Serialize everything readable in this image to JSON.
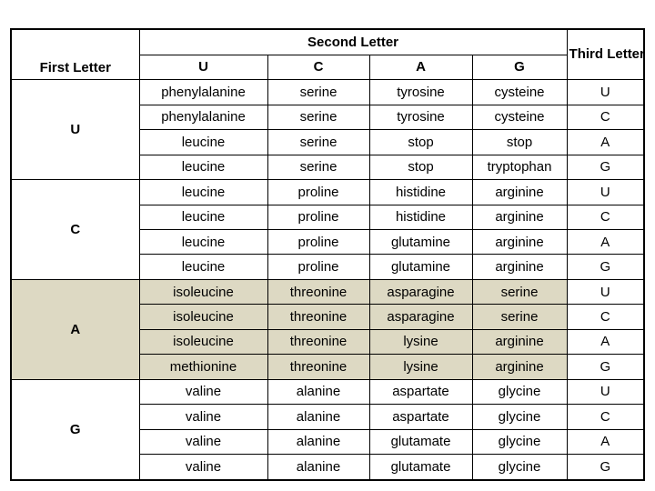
{
  "table": {
    "headers": {
      "first_letter": "First Letter",
      "second_letter": "Second Letter",
      "third_letter": "Third Letter",
      "second_letter_columns": [
        "U",
        "C",
        "A",
        "G"
      ]
    },
    "highlight_color": "#DDD9C3",
    "highlighted_block": "A",
    "blocks": [
      {
        "first_letter": "U",
        "shaded": false,
        "rows": [
          {
            "third_letter": "U",
            "cells": [
              "phenylalanine",
              "serine",
              "tyrosine",
              "cysteine"
            ]
          },
          {
            "third_letter": "C",
            "cells": [
              "phenylalanine",
              "serine",
              "tyrosine",
              "cysteine"
            ]
          },
          {
            "third_letter": "A",
            "cells": [
              "leucine",
              "serine",
              "stop",
              "stop"
            ]
          },
          {
            "third_letter": "G",
            "cells": [
              "leucine",
              "serine",
              "stop",
              "tryptophan"
            ]
          }
        ]
      },
      {
        "first_letter": "C",
        "shaded": false,
        "rows": [
          {
            "third_letter": "U",
            "cells": [
              "leucine",
              "proline",
              "histidine",
              "arginine"
            ]
          },
          {
            "third_letter": "C",
            "cells": [
              "leucine",
              "proline",
              "histidine",
              "arginine"
            ]
          },
          {
            "third_letter": "A",
            "cells": [
              "leucine",
              "proline",
              "glutamine",
              "arginine"
            ]
          },
          {
            "third_letter": "G",
            "cells": [
              "leucine",
              "proline",
              "glutamine",
              "arginine"
            ]
          }
        ]
      },
      {
        "first_letter": "A",
        "shaded": true,
        "rows": [
          {
            "third_letter": "U",
            "cells": [
              "isoleucine",
              "threonine",
              "asparagine",
              "serine"
            ]
          },
          {
            "third_letter": "C",
            "cells": [
              "isoleucine",
              "threonine",
              "asparagine",
              "serine"
            ]
          },
          {
            "third_letter": "A",
            "cells": [
              "isoleucine",
              "threonine",
              "lysine",
              "arginine"
            ]
          },
          {
            "third_letter": "G",
            "cells": [
              "methionine",
              "threonine",
              "lysine",
              "arginine"
            ]
          }
        ]
      },
      {
        "first_letter": "G",
        "shaded": false,
        "rows": [
          {
            "third_letter": "U",
            "cells": [
              "valine",
              "alanine",
              "aspartate",
              "glycine"
            ]
          },
          {
            "third_letter": "C",
            "cells": [
              "valine",
              "alanine",
              "aspartate",
              "glycine"
            ]
          },
          {
            "third_letter": "A",
            "cells": [
              "valine",
              "alanine",
              "glutamate",
              "glycine"
            ]
          },
          {
            "third_letter": "G",
            "cells": [
              "valine",
              "alanine",
              "glutamate",
              "glycine"
            ]
          }
        ]
      }
    ]
  }
}
